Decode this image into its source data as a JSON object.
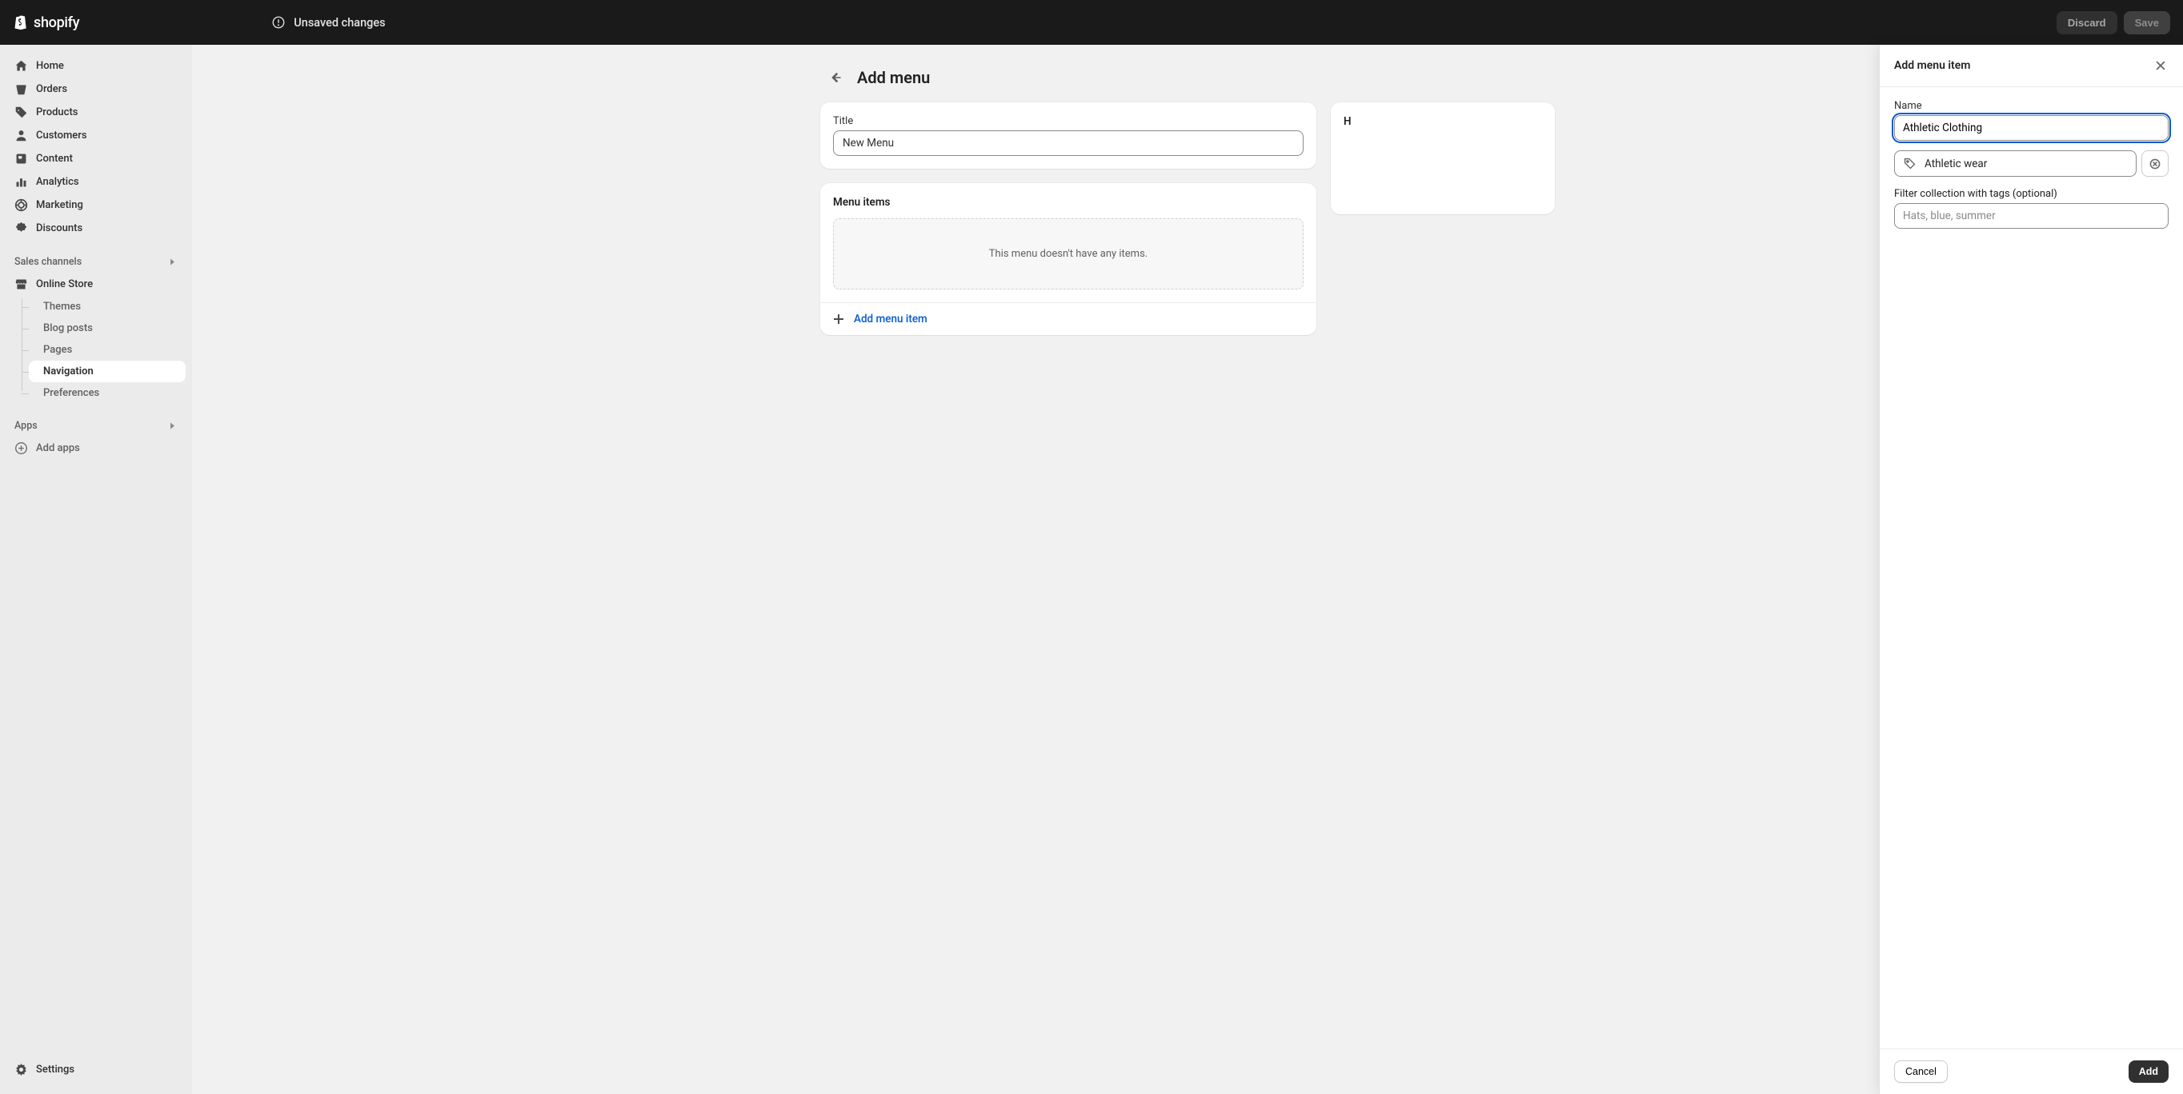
{
  "brand": "shopify",
  "header": {
    "unsaved": "Unsaved changes",
    "discard": "Discard",
    "save": "Save"
  },
  "sidebar": {
    "items": [
      {
        "label": "Home"
      },
      {
        "label": "Orders"
      },
      {
        "label": "Products"
      },
      {
        "label": "Customers"
      },
      {
        "label": "Content"
      },
      {
        "label": "Analytics"
      },
      {
        "label": "Marketing"
      },
      {
        "label": "Discounts"
      }
    ],
    "sales_channels": "Sales channels",
    "online_store": "Online Store",
    "sub_items": [
      {
        "label": "Themes"
      },
      {
        "label": "Blog posts"
      },
      {
        "label": "Pages"
      },
      {
        "label": "Navigation"
      },
      {
        "label": "Preferences"
      }
    ],
    "apps": "Apps",
    "add_apps": "Add apps",
    "settings": "Settings"
  },
  "page": {
    "title": "Add menu",
    "title_label": "Title",
    "title_value": "New Menu",
    "menu_items_title": "Menu items",
    "empty_msg": "This menu doesn't have any items.",
    "add_item": "Add menu item",
    "how_to_title": "H"
  },
  "panel": {
    "title": "Add menu item",
    "name_label": "Name",
    "name_value": "Athletic Clothing",
    "link_value": "Athletic wear",
    "filter_label": "Filter collection with tags (optional)",
    "filter_placeholder": "Hats, blue, summer",
    "cancel": "Cancel",
    "add": "Add"
  }
}
